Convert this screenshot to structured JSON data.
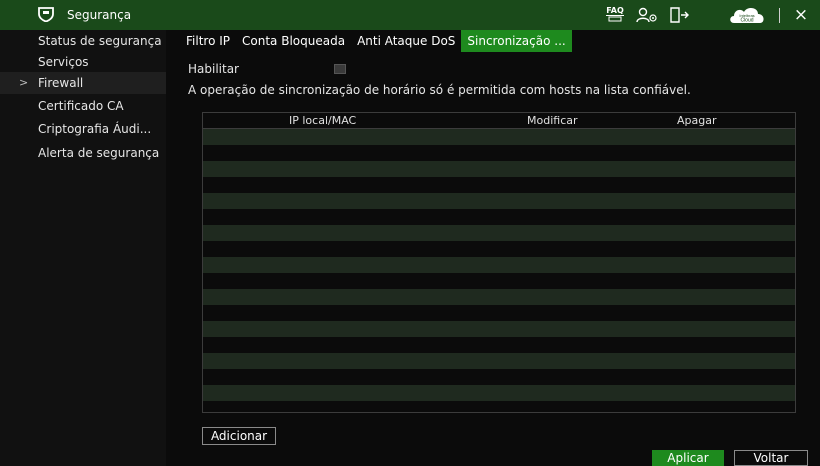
{
  "titlebar": {
    "title": "Segurança",
    "faq_top": "FAQ",
    "cloud_top": "Intelbras",
    "cloud_bottom": "Cloud",
    "icons": [
      "shield-icon",
      "faq-icon",
      "user-icon",
      "exit-icon",
      "cloud-icon",
      "close-icon"
    ],
    "close_glyph": "×"
  },
  "sidebar": {
    "items": [
      {
        "label": "Status de segurança",
        "active": false
      },
      {
        "label": "Serviços",
        "active": false
      },
      {
        "label": "Firewall",
        "active": true
      },
      {
        "label": "Certificado CA",
        "active": false
      },
      {
        "label": "Criptografia Áudi...",
        "active": false
      },
      {
        "label": "Alerta de segurança",
        "active": false
      }
    ],
    "active_marker": ">"
  },
  "tabs": [
    {
      "label": "Filtro IP",
      "active": false
    },
    {
      "label": "Conta Bloqueada",
      "active": false
    },
    {
      "label": "Anti Ataque DoS",
      "active": false
    },
    {
      "label": "Sincronização ...",
      "active": true
    }
  ],
  "form": {
    "enable_label": "Habilitar",
    "enable_checked": false,
    "note": "A operação de sincronização de horário só é permitida com hosts na lista confiável."
  },
  "table": {
    "columns": [
      "IP local/MAC",
      "Modificar",
      "Apagar"
    ],
    "rows": []
  },
  "buttons": {
    "add": "Adicionar",
    "apply": "Aplicar",
    "back": "Voltar"
  },
  "colors": {
    "titlebar": "#1a4a1a",
    "accent": "#1e8a1e",
    "row_stripe": "#1f2a1f"
  }
}
